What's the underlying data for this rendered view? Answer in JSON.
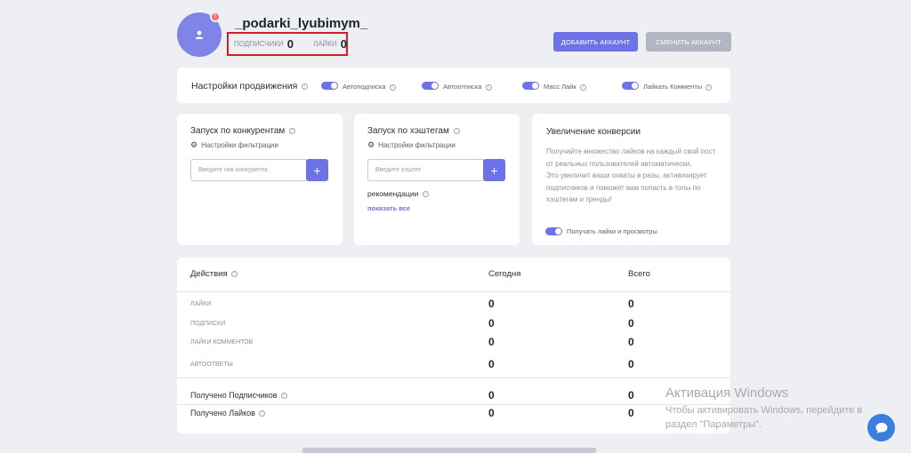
{
  "profile": {
    "username": "_podarki_lyubimym_",
    "notification_badge": "!",
    "followers_label": "ПОДПИСЧИКИ",
    "followers_count": "0",
    "likes_label": "ЛАЙКИ",
    "likes_count": "0"
  },
  "buttons": {
    "add_account": "ДОБАВИТЬ АККАУНТ",
    "switch_account": "СМЕНИТЬ АККАУНТ"
  },
  "promotion_settings": {
    "title": "Настройки продвижения",
    "toggles": [
      {
        "label": "Автоподписка",
        "on": true
      },
      {
        "label": "Автоотписка",
        "on": true
      },
      {
        "label": "Масс Лайк",
        "on": true
      },
      {
        "label": "Лайкать Комменты",
        "on": true
      }
    ]
  },
  "competitors": {
    "title": "Запуск по конкурентам",
    "filter_link": "Настройки фильтрации",
    "input_placeholder": "Введите ник конкурента",
    "add_symbol": "+"
  },
  "hashtags": {
    "title": "Запуск по хэштегам",
    "filter_link": "Настройки фильтрации",
    "input_placeholder": "Введите хэштег",
    "add_symbol": "+",
    "recommendations_label": "рекомендации",
    "show_all": "показать все"
  },
  "conversion": {
    "title": "Увеличение конверсии",
    "description_1": "Получайте множество лайков на каждый свой пост от реальных пользователей автоматически.",
    "description_2": "Это увеличит ваши охваты в разы, активизирует подписчиков и поможет вам попасть в топы по хэштегам и тренды!",
    "toggle_label": "Получать лайки и просмотры"
  },
  "actions": {
    "header_action": "Действия",
    "header_today": "Сегодня",
    "header_total": "Всего",
    "rows": [
      {
        "label": "ЛАЙКИ",
        "today": "0",
        "total": "0"
      },
      {
        "label": "ПОДПИСКИ",
        "today": "0",
        "total": "0"
      },
      {
        "label": "ЛАЙКИ КОММЕНТОВ",
        "today": "0",
        "total": "0"
      },
      {
        "label": "АВТООТВЕТЫ",
        "today": "0",
        "total": "0"
      }
    ],
    "received": [
      {
        "label": "Получено Подписчиков",
        "today": "0",
        "total": "0"
      },
      {
        "label": "Получено Лайков",
        "today": "0",
        "total": "0"
      }
    ]
  },
  "watermark": {
    "title": "Активация Windows",
    "line1": "Чтобы активировать Windows, перейдите в",
    "line2": "раздел \"Параметры\"."
  },
  "colors": {
    "accent": "#6d72e6",
    "background": "#eeeff3",
    "highlight_border": "#d21f26"
  }
}
